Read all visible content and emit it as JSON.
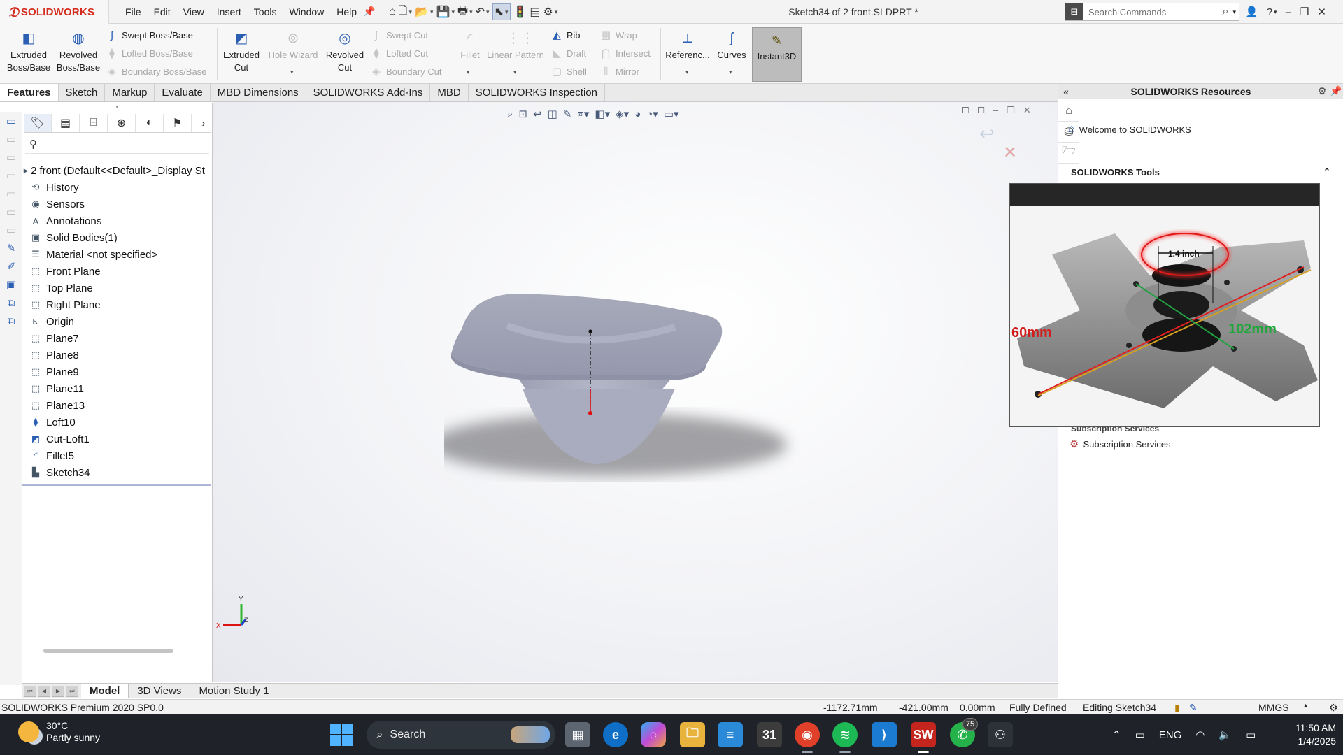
{
  "app": {
    "logo_text": "SOLIDWORKS",
    "menus": [
      "File",
      "Edit",
      "View",
      "Insert",
      "Tools",
      "Window",
      "Help"
    ],
    "document_title": "Sketch34 of 2 front.SLDPRT *",
    "search_placeholder": "Search Commands"
  },
  "command_manager": {
    "extruded_boss": "Extruded\nBoss/Base",
    "revolved_boss": "Revolved\nBoss/Base",
    "swept_boss": "Swept Boss/Base",
    "lofted_boss": "Lofted Boss/Base",
    "boundary_boss": "Boundary Boss/Base",
    "extruded_cut": "Extruded\nCut",
    "hole_wizard": "Hole Wizard",
    "revolved_cut": "Revolved\nCut",
    "swept_cut": "Swept Cut",
    "lofted_cut": "Lofted Cut",
    "boundary_cut": "Boundary Cut",
    "fillet": "Fillet",
    "linear_pattern": "Linear Pattern",
    "rib": "Rib",
    "draft": "Draft",
    "shell": "Shell",
    "wrap": "Wrap",
    "intersect": "Intersect",
    "mirror": "Mirror",
    "reference": "Referenc...",
    "curves": "Curves",
    "instant3d": "Instant3D"
  },
  "tabs": [
    "Features",
    "Sketch",
    "Markup",
    "Evaluate",
    "MBD Dimensions",
    "SOLIDWORKS Add-Ins",
    "MBD",
    "SOLIDWORKS Inspection"
  ],
  "feature_tree": {
    "root": "2 front  (Default<<Default>_Display St",
    "items": [
      {
        "label": "History",
        "icon": "history-icon"
      },
      {
        "label": "Sensors",
        "icon": "sensors-icon"
      },
      {
        "label": "Annotations",
        "icon": "annotations-icon"
      },
      {
        "label": "Solid Bodies(1)",
        "icon": "solid-bodies-icon"
      },
      {
        "label": "Material <not specified>",
        "icon": "material-icon"
      },
      {
        "label": "Front Plane",
        "icon": "plane-icon"
      },
      {
        "label": "Top Plane",
        "icon": "plane-icon"
      },
      {
        "label": "Right Plane",
        "icon": "plane-icon"
      },
      {
        "label": "Origin",
        "icon": "origin-icon"
      },
      {
        "label": "Plane7",
        "icon": "plane-icon"
      },
      {
        "label": "Plane8",
        "icon": "plane-icon"
      },
      {
        "label": "Plane9",
        "icon": "plane-icon"
      },
      {
        "label": "Plane11",
        "icon": "plane-icon"
      },
      {
        "label": "Plane13",
        "icon": "plane-icon"
      },
      {
        "label": "Loft10",
        "icon": "loft-icon"
      },
      {
        "label": "Cut-Loft1",
        "icon": "cut-loft-icon"
      },
      {
        "label": "Fillet5",
        "icon": "fillet-icon"
      },
      {
        "label": "Sketch34",
        "icon": "sketch-icon"
      }
    ]
  },
  "bottom_tabs": [
    "Model",
    "3D Views",
    "Motion Study 1"
  ],
  "task_pane": {
    "title": "SOLIDWORKS Resources",
    "welcome": "Welcome to SOLIDWORKS",
    "tools_header": "SOLIDWORKS Tools",
    "subscription_header": "Subscription Services",
    "subscription_item": "Subscription Services"
  },
  "photo": {
    "dim_top": "1.4 inch",
    "dim_left": "60mm",
    "dim_right": "102mm"
  },
  "status_bar": {
    "product": "SOLIDWORKS Premium 2020 SP0.0",
    "x": "-1172.71mm",
    "y": "-421.00mm",
    "z": "0.00mm",
    "state": "Fully Defined",
    "editing": "Editing Sketch34",
    "units": "MMGS"
  },
  "taskbar": {
    "temperature": "30°C",
    "condition": "Partly sunny",
    "search_label": "Search",
    "whatsapp_badge": "75",
    "language": "ENG",
    "time": "11:50 AM",
    "date": "1/4/2025"
  },
  "colors": {
    "brand_red": "#d52b1e",
    "accent_blue": "#2a5fb4",
    "model_gray": "#a2a6b8"
  }
}
